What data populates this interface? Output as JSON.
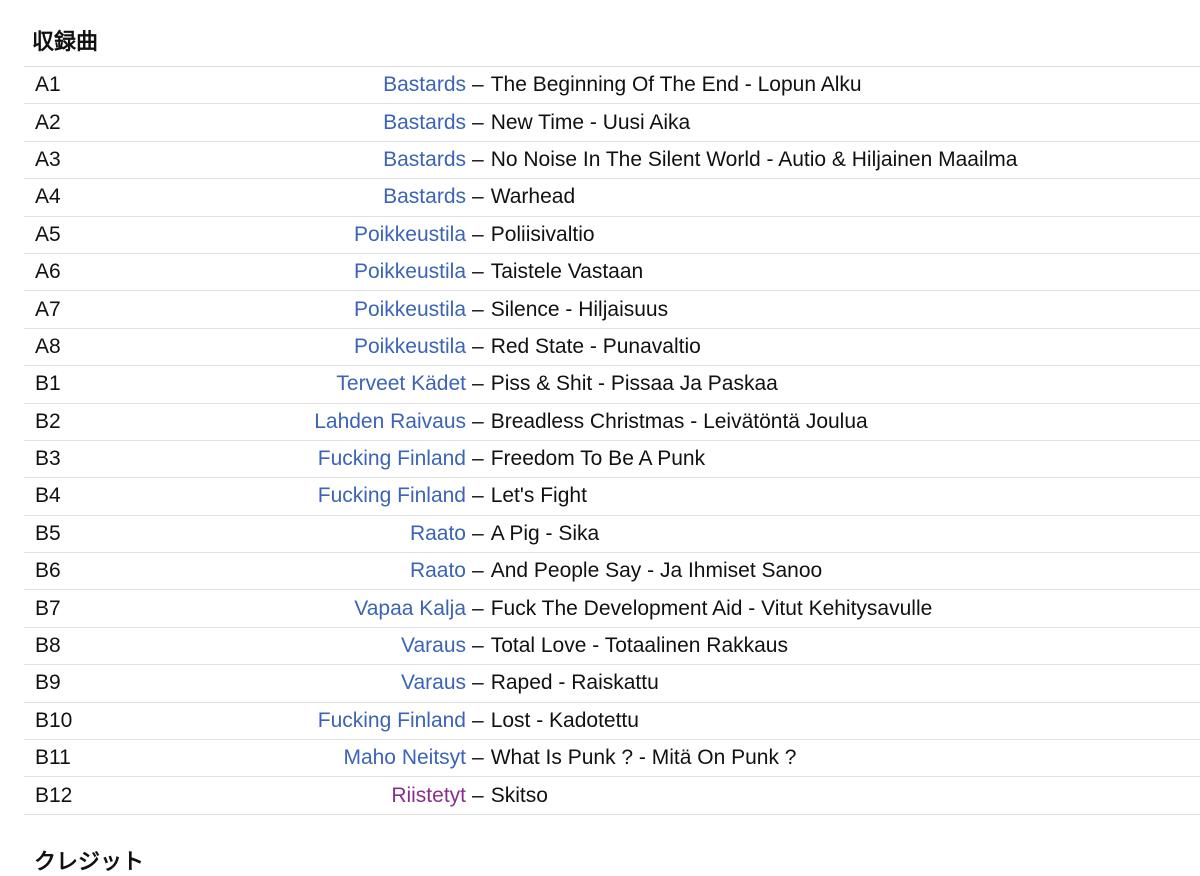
{
  "section": {
    "title": "収録曲",
    "next_heading": "クレジット"
  },
  "colors": {
    "artist_link": "#3b63b7",
    "artist_link_visited": "#8a2e8c",
    "divider": "#e2e2e2"
  },
  "tracks": [
    {
      "pos": "A1",
      "artist": "Bastards",
      "sep": "–",
      "title": "The Beginning Of The End - Lopun Alku",
      "visited": false
    },
    {
      "pos": "A2",
      "artist": "Bastards",
      "sep": "–",
      "title": "New Time - Uusi Aika",
      "visited": false
    },
    {
      "pos": "A3",
      "artist": "Bastards",
      "sep": "–",
      "title": "No Noise In The Silent World - Autio & Hiljainen Maailma",
      "visited": false
    },
    {
      "pos": "A4",
      "artist": "Bastards",
      "sep": "–",
      "title": "Warhead",
      "visited": false
    },
    {
      "pos": "A5",
      "artist": "Poikkeustila",
      "sep": "–",
      "title": "Poliisivaltio",
      "visited": false
    },
    {
      "pos": "A6",
      "artist": "Poikkeustila",
      "sep": "–",
      "title": "Taistele Vastaan",
      "visited": false
    },
    {
      "pos": "A7",
      "artist": "Poikkeustila",
      "sep": "–",
      "title": "Silence - Hiljaisuus",
      "visited": false
    },
    {
      "pos": "A8",
      "artist": "Poikkeustila",
      "sep": "–",
      "title": "Red State - Punavaltio",
      "visited": false
    },
    {
      "pos": "B1",
      "artist": "Terveet Kädet",
      "sep": "–",
      "title": "Piss & Shit - Pissaa Ja Paskaa",
      "visited": false
    },
    {
      "pos": "B2",
      "artist": "Lahden Raivaus",
      "sep": "–",
      "title": "Breadless Christmas - Leivätöntä Joulua",
      "visited": false
    },
    {
      "pos": "B3",
      "artist": "Fucking Finland",
      "sep": "–",
      "title": "Freedom To Be A Punk",
      "visited": false
    },
    {
      "pos": "B4",
      "artist": "Fucking Finland",
      "sep": "–",
      "title": "Let's Fight",
      "visited": false
    },
    {
      "pos": "B5",
      "artist": "Raato",
      "sep": "–",
      "title": "A Pig - Sika",
      "visited": false
    },
    {
      "pos": "B6",
      "artist": "Raato",
      "sep": "–",
      "title": "And People Say - Ja Ihmiset Sanoo",
      "visited": false
    },
    {
      "pos": "B7",
      "artist": "Vapaa Kalja",
      "sep": "–",
      "title": "Fuck The Development Aid - Vitut Kehitysavulle",
      "visited": false
    },
    {
      "pos": "B8",
      "artist": "Varaus",
      "sep": "–",
      "title": "Total Love - Totaalinen Rakkaus",
      "visited": false
    },
    {
      "pos": "B9",
      "artist": "Varaus",
      "sep": "–",
      "title": "Raped - Raiskattu",
      "visited": false
    },
    {
      "pos": "B10",
      "artist": "Fucking Finland",
      "sep": "–",
      "title": "Lost - Kadotettu",
      "visited": false
    },
    {
      "pos": "B11",
      "artist": "Maho Neitsyt",
      "sep": "–",
      "title": "What Is Punk ? - Mitä On Punk ?",
      "visited": false
    },
    {
      "pos": "B12",
      "artist": "Riistetyt",
      "sep": "–",
      "title": "Skitso",
      "visited": true
    }
  ]
}
